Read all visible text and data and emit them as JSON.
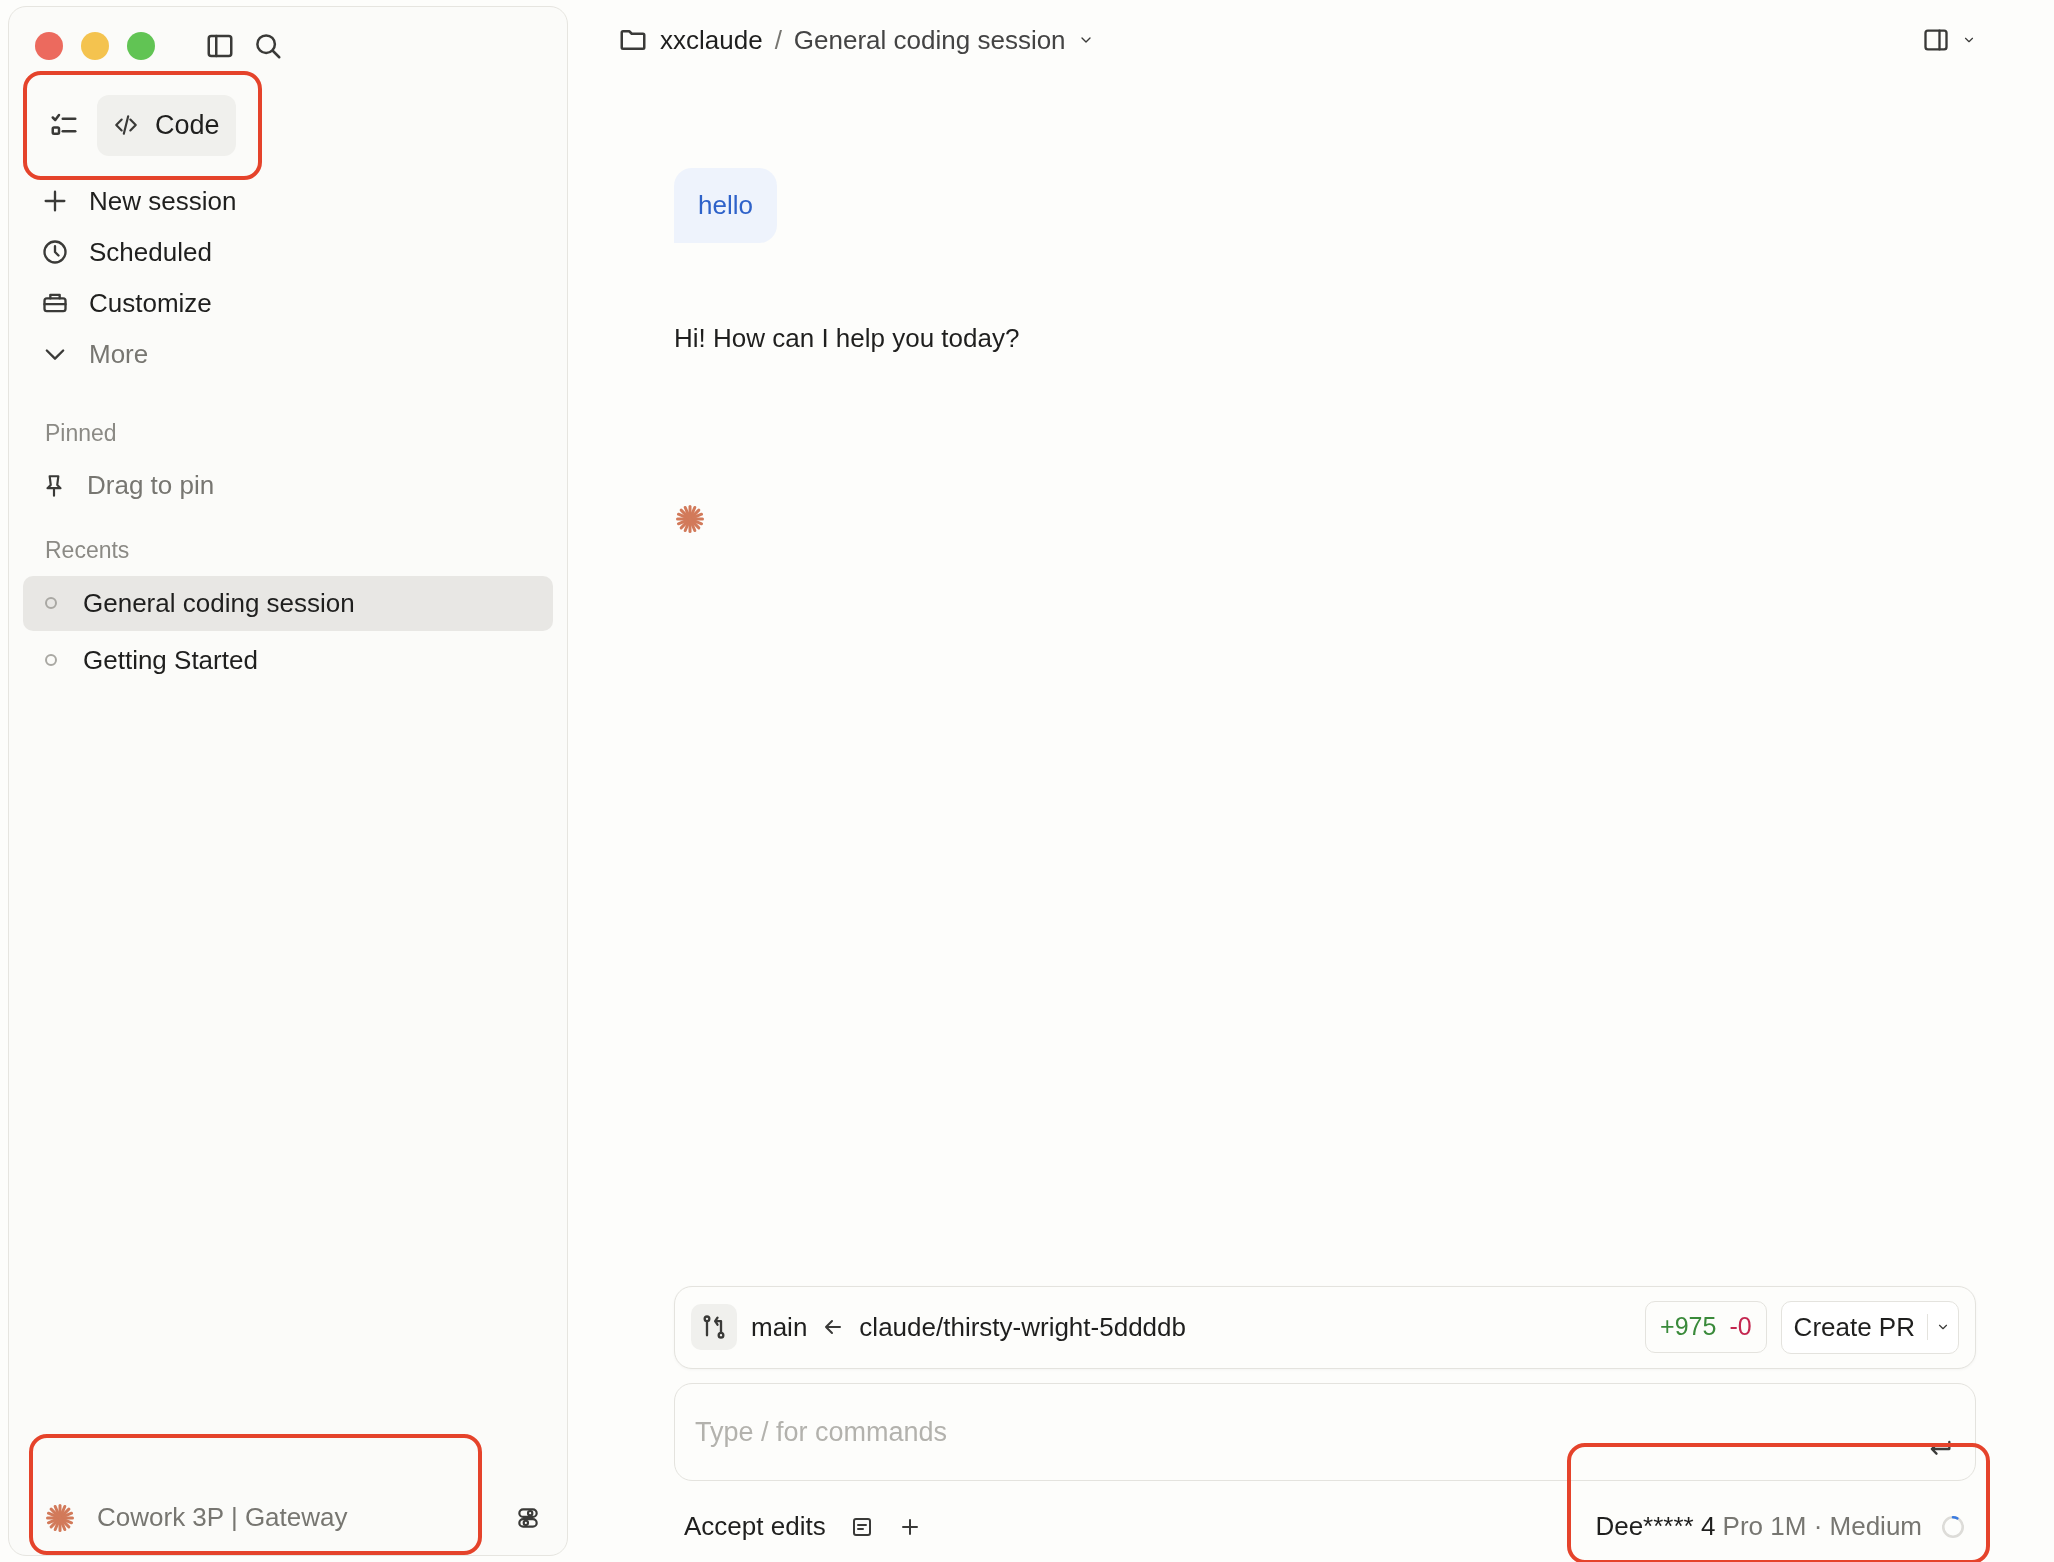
{
  "window": {
    "controls": [
      {
        "kind": "close"
      },
      {
        "kind": "minimize"
      },
      {
        "kind": "zoom"
      }
    ]
  },
  "sidebar": {
    "mode": {
      "label": "Code",
      "highlighted": true
    },
    "nav": [
      {
        "label": "New session",
        "kind": "plus",
        "muted": false
      },
      {
        "label": "Scheduled",
        "kind": "clock",
        "muted": false
      },
      {
        "label": "Customize",
        "kind": "briefcase",
        "muted": false
      },
      {
        "label": "More",
        "kind": "chevron",
        "muted": true
      }
    ],
    "pinned": {
      "heading": "Pinned",
      "hint": "Drag to pin"
    },
    "recents": {
      "heading": "Recents",
      "items": [
        {
          "label": "General coding session",
          "selected": true
        },
        {
          "label": "Getting Started",
          "selected": false
        }
      ]
    },
    "footer": {
      "label": "Cowork 3P | Gateway",
      "highlighted": true
    }
  },
  "header": {
    "folder": "xxclaude",
    "separator": "/",
    "session": "General coding session"
  },
  "messages": [
    {
      "kind": "user",
      "text": "hello"
    },
    {
      "kind": "assistant",
      "text": "Hi! How can I help you today?"
    }
  ],
  "branch_bar": {
    "base": "main",
    "head": "claude/thirsty-wright-5ddddb",
    "additions": "+975",
    "deletions": "-0",
    "button": "Create PR"
  },
  "composer": {
    "placeholder": "Type / for commands"
  },
  "toolbar": {
    "mode": "Accept edits",
    "model": {
      "name": "Dee***** 4",
      "detail": "Pro 1M · Medium",
      "highlighted": true
    }
  }
}
